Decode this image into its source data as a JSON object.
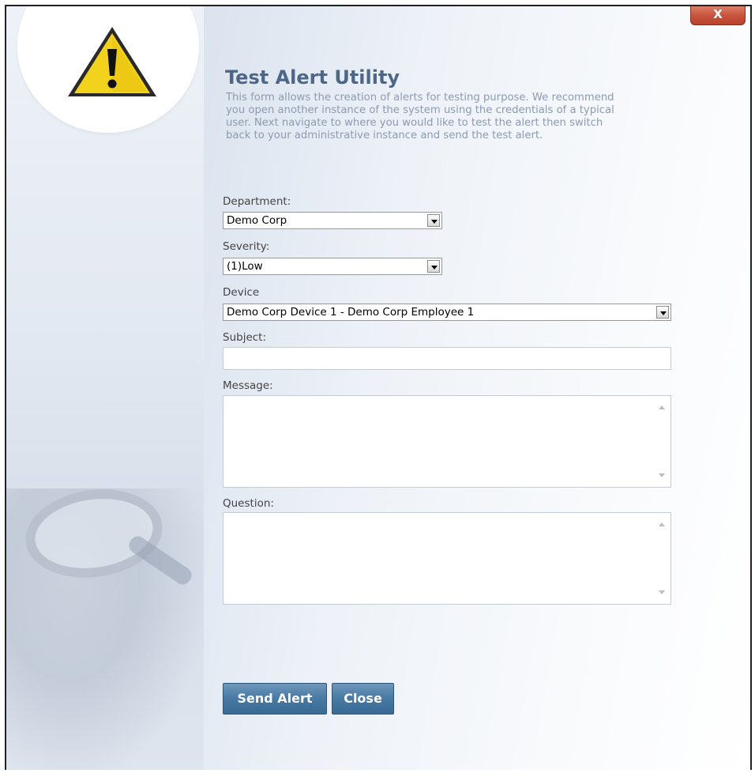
{
  "dialog": {
    "close_label": "X",
    "title": "Test Alert Utility",
    "description": "This form allows the creation of alerts for testing purpose. We recommend you open another instance of the system using the credentials of a typical user. Next navigate to where you would like to test the alert then switch back to your administrative instance and send the test alert."
  },
  "form": {
    "department": {
      "label": "Department:",
      "value": "Demo Corp"
    },
    "severity": {
      "label": "Severity:",
      "value": "(1)Low"
    },
    "device": {
      "label": "Device",
      "value": "Demo Corp Device 1 - Demo Corp Employee 1"
    },
    "subject": {
      "label": "Subject:",
      "value": ""
    },
    "message": {
      "label": "Message:",
      "value": ""
    },
    "question": {
      "label": "Question:",
      "value": ""
    }
  },
  "buttons": {
    "send_label": "Send Alert",
    "close_label": "Close"
  },
  "icons": {
    "warning": "warning-triangle-icon",
    "close": "close-icon"
  },
  "colors": {
    "accent": "#4779a3",
    "title": "#4e6788",
    "close": "#c9553e",
    "warning": "#f2d21c"
  }
}
